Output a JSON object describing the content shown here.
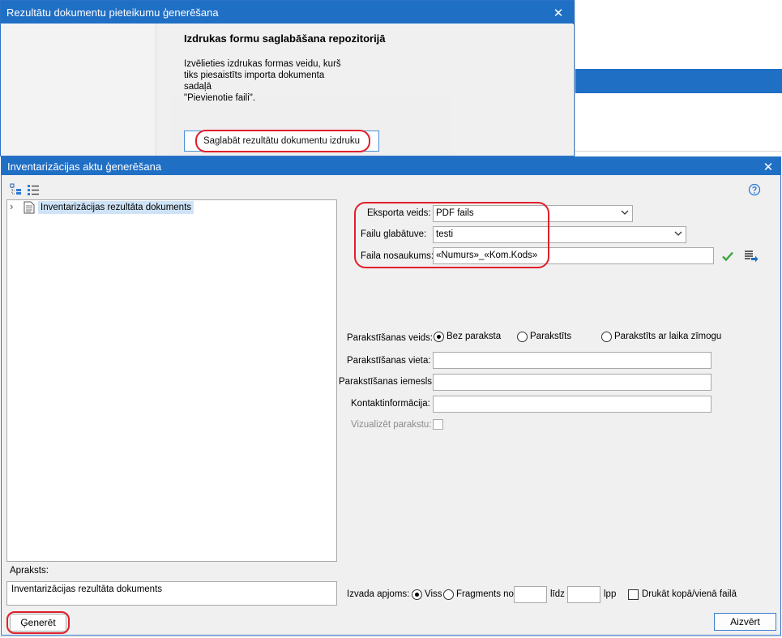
{
  "back_window": {
    "title": "Rezultātu dokumentu pieteikumu ģenerēšana",
    "heading": "Izdrukas formu saglabāšana repozitorijā",
    "description_lines": [
      "Izvēlieties izdrukas formas veidu, kurš",
      "tiks piesaistīts importa dokumenta sadaļā",
      "\"Pievienotie faili\"."
    ],
    "save_button_label": "Saglabāt rezultātu dokumentu izdruku",
    "close_glyph": "✕"
  },
  "front_window": {
    "title": "Inventarizācijas aktu ģenerēšana",
    "close_glyph": "✕",
    "tree": {
      "expander": "›",
      "items": [
        "Inventarizācijas rezultāta dokuments"
      ]
    },
    "export": {
      "type_label": "Eksporta veids:",
      "type_value": "PDF fails",
      "storage_label": "Failu glabātuve:",
      "storage_value": "testi",
      "filename_label": "Faila nosaukums:",
      "filename_value": "«Numurs»_«Kom.Kods»"
    },
    "signature": {
      "type_label": "Parakstīšanas veids:",
      "options": [
        "Bez paraksta",
        "Parakstīts",
        "Parakstīts ar laika zīmogu"
      ],
      "selected": "Bez paraksta",
      "place_label": "Parakstīšanas vieta:",
      "place_value": "",
      "reason_label": "Parakstīšanas iemesls:",
      "reason_value": "",
      "contact_label": "Kontaktinformācija:",
      "contact_value": "",
      "visualize_label": "Vizualizēt parakstu:"
    },
    "description": {
      "label": "Apraksts:",
      "value": "Inventarizācijas rezultāta dokuments"
    },
    "output": {
      "label": "Izvada apjoms:",
      "all_label": "Viss",
      "fragment_label": "Fragments no",
      "fragment_from": "",
      "to_label": "līdz",
      "fragment_to": "",
      "pages_label": "lpp",
      "print_together_label": "Drukāt kopā/vienā failā"
    },
    "generate_button_label": "Ģenerēt",
    "close_button_label": "Aizvērt"
  },
  "icons": [
    "tree-expand-icon",
    "list-icon",
    "help-icon",
    "document-icon",
    "apply-check-icon",
    "field-list-icon",
    "dropdown-arrow-icon"
  ],
  "colors": {
    "titlebar": "#1f6fc5",
    "highlight": "#e0202b",
    "selection": "#cfe3f7"
  }
}
